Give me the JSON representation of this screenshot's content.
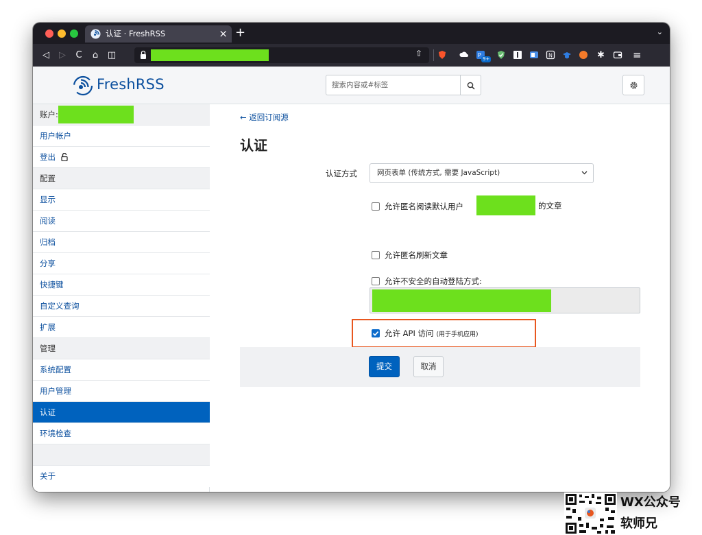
{
  "browser": {
    "tab_title": "认证 · FreshRSS",
    "tab_close": "×",
    "new_tab": "+",
    "tab_list": "⌄",
    "nav_back": "◁",
    "nav_forward": "▷",
    "nav_reload": "C",
    "nav_home": "⌂",
    "nav_pocket": "◫",
    "url_share": "⇧",
    "ext_badge": "9+",
    "menu": "≡"
  },
  "header": {
    "logo_text": "FreshRSS",
    "search_placeholder": "搜索内容或#标签",
    "accent_color": "#0062be"
  },
  "sidebar": {
    "account_label": "账户:",
    "items": [
      {
        "label": "用户帐户",
        "kind": "link"
      },
      {
        "label": "登出",
        "kind": "link"
      },
      {
        "label": "配置",
        "kind": "section"
      },
      {
        "label": "显示",
        "kind": "link"
      },
      {
        "label": "阅读",
        "kind": "link"
      },
      {
        "label": "归档",
        "kind": "link"
      },
      {
        "label": "分享",
        "kind": "link"
      },
      {
        "label": "快捷键",
        "kind": "link"
      },
      {
        "label": "自定义查询",
        "kind": "link"
      },
      {
        "label": "扩展",
        "kind": "link"
      },
      {
        "label": "管理",
        "kind": "section"
      },
      {
        "label": "系统配置",
        "kind": "link"
      },
      {
        "label": "用户管理",
        "kind": "link"
      },
      {
        "label": "认证",
        "kind": "active"
      },
      {
        "label": "环境检查",
        "kind": "link"
      },
      {
        "label": "关于",
        "kind": "link"
      }
    ]
  },
  "main": {
    "back_link": "← 返回订阅源",
    "title": "认证",
    "auth_method_label": "认证方式",
    "auth_method_value": "网页表单 (传统方式, 需要 JavaScript)",
    "checkboxes": {
      "anon_read_prefix": "允许匿名阅读默认用户",
      "anon_read_suffix": "的文章",
      "anon_refresh": "允许匿名刷新文章",
      "unsafe_autologin": "允许不安全的自动登陆方式:",
      "api_access": "允许 API 访问",
      "api_access_note": "(用于手机应用)"
    },
    "checked": {
      "anon_read": false,
      "anon_refresh": false,
      "unsafe_autologin": false,
      "api_access": true
    },
    "submit_label": "提交",
    "cancel_label": "取消"
  },
  "watermark": {
    "line1": "WX公众号",
    "line2": "软师兄"
  }
}
